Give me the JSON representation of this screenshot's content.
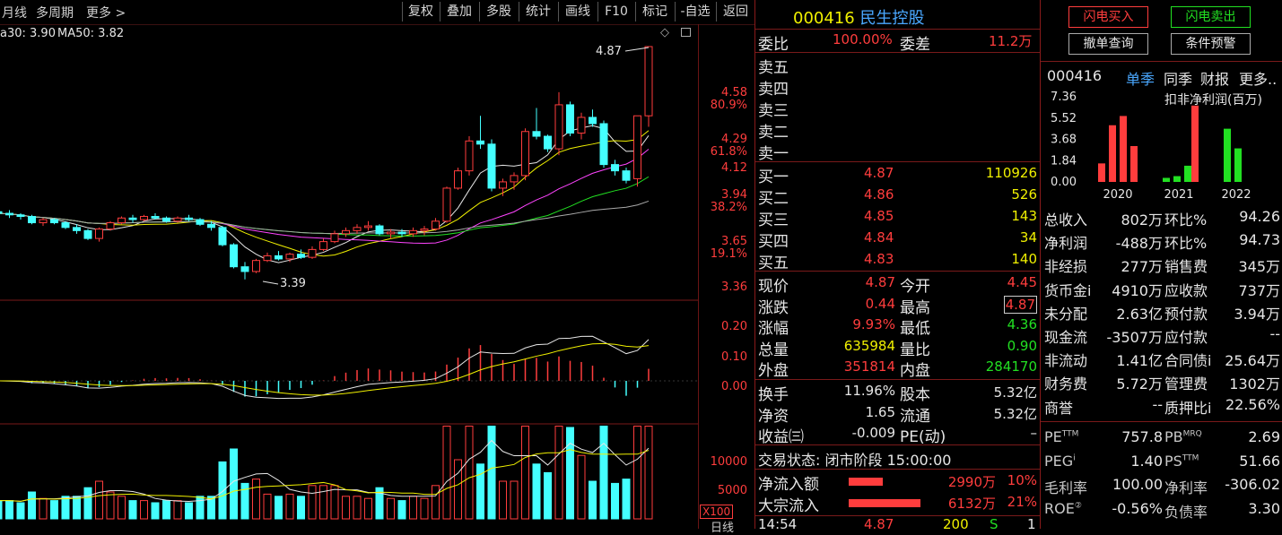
{
  "toolbar": {
    "tabs": [
      "月线",
      "多周期",
      "更多 >"
    ],
    "buttons": [
      "复权",
      "叠加",
      "多股",
      "统计",
      "画线",
      "F10",
      "标记",
      "-自选",
      "返回"
    ]
  },
  "ma_legend": {
    "ma30": "a30: 3.90",
    "ma50": "MA50: 3.82"
  },
  "price_axis": [
    {
      "label": "4.58",
      "color": "#ff3d3d"
    },
    {
      "label": "80.9%",
      "color": "#ff3d3d"
    },
    {
      "label": "4.29",
      "color": "#ff3d3d"
    },
    {
      "label": "61.8%",
      "color": "#ff3d3d"
    },
    {
      "label": "4.12",
      "color": "#ff3d3d"
    },
    {
      "label": "3.94",
      "color": "#ff3d3d"
    },
    {
      "label": "38.2%",
      "color": "#ff3d3d"
    },
    {
      "label": "3.65",
      "color": "#ff3d3d"
    },
    {
      "label": "19.1%",
      "color": "#ff3d3d"
    },
    {
      "label": "3.36",
      "color": "#ff3d3d"
    }
  ],
  "price_marks": {
    "high": "4.87",
    "low": "3.39"
  },
  "macd_axis": [
    "0.20",
    "0.10",
    "0.00"
  ],
  "vol_axis": [
    "10000",
    "5000"
  ],
  "vol_unit": "X100",
  "bottom_right": "日线",
  "chart_data": {
    "type": "candlestick",
    "candles": [
      [
        3.82,
        3.84,
        3.79,
        3.81
      ],
      [
        3.81,
        3.83,
        3.78,
        3.8
      ],
      [
        3.8,
        3.81,
        3.77,
        3.79
      ],
      [
        3.79,
        3.8,
        3.74,
        3.75
      ],
      [
        3.75,
        3.78,
        3.73,
        3.77
      ],
      [
        3.77,
        3.78,
        3.74,
        3.75
      ],
      [
        3.75,
        3.76,
        3.71,
        3.72
      ],
      [
        3.72,
        3.74,
        3.68,
        3.7
      ],
      [
        3.7,
        3.71,
        3.64,
        3.65
      ],
      [
        3.65,
        3.72,
        3.63,
        3.71
      ],
      [
        3.71,
        3.76,
        3.7,
        3.75
      ],
      [
        3.75,
        3.79,
        3.74,
        3.78
      ],
      [
        3.78,
        3.8,
        3.75,
        3.77
      ],
      [
        3.77,
        3.8,
        3.76,
        3.79
      ],
      [
        3.79,
        3.81,
        3.77,
        3.78
      ],
      [
        3.78,
        3.79,
        3.75,
        3.76
      ],
      [
        3.76,
        3.79,
        3.75,
        3.78
      ],
      [
        3.78,
        3.8,
        3.76,
        3.77
      ],
      [
        3.77,
        3.78,
        3.73,
        3.74
      ],
      [
        3.74,
        3.76,
        3.7,
        3.72
      ],
      [
        3.72,
        3.73,
        3.6,
        3.61
      ],
      [
        3.61,
        3.62,
        3.46,
        3.47
      ],
      [
        3.47,
        3.5,
        3.39,
        3.44
      ],
      [
        3.44,
        3.52,
        3.43,
        3.51
      ],
      [
        3.51,
        3.56,
        3.5,
        3.54
      ],
      [
        3.54,
        3.57,
        3.51,
        3.52
      ],
      [
        3.52,
        3.56,
        3.5,
        3.55
      ],
      [
        3.55,
        3.58,
        3.52,
        3.53
      ],
      [
        3.53,
        3.6,
        3.52,
        3.58
      ],
      [
        3.58,
        3.65,
        3.57,
        3.63
      ],
      [
        3.63,
        3.7,
        3.62,
        3.68
      ],
      [
        3.68,
        3.72,
        3.66,
        3.7
      ],
      [
        3.7,
        3.74,
        3.68,
        3.72
      ],
      [
        3.72,
        3.76,
        3.7,
        3.73
      ],
      [
        3.73,
        3.74,
        3.67,
        3.68
      ],
      [
        3.68,
        3.71,
        3.65,
        3.69
      ],
      [
        3.69,
        3.71,
        3.66,
        3.68
      ],
      [
        3.68,
        3.72,
        3.66,
        3.7
      ],
      [
        3.7,
        3.73,
        3.67,
        3.71
      ],
      [
        3.71,
        3.78,
        3.7,
        3.76
      ],
      [
        3.76,
        3.98,
        3.75,
        3.97
      ],
      [
        3.97,
        4.1,
        3.96,
        4.08
      ],
      [
        4.08,
        4.3,
        4.05,
        4.27
      ],
      [
        4.27,
        4.43,
        4.22,
        4.25
      ],
      [
        4.25,
        4.28,
        3.95,
        3.97
      ],
      [
        3.97,
        4.03,
        3.92,
        4.01
      ],
      [
        4.01,
        4.07,
        3.96,
        4.05
      ],
      [
        4.05,
        4.35,
        4.02,
        4.33
      ],
      [
        4.33,
        4.48,
        4.28,
        4.3
      ],
      [
        4.3,
        4.31,
        4.2,
        4.22
      ],
      [
        4.22,
        4.58,
        4.18,
        4.5
      ],
      [
        4.5,
        4.52,
        4.3,
        4.32
      ],
      [
        4.32,
        4.45,
        4.28,
        4.42
      ],
      [
        4.42,
        4.47,
        4.36,
        4.38
      ],
      [
        4.38,
        4.4,
        4.1,
        4.12
      ],
      [
        4.12,
        4.15,
        4.05,
        4.08
      ],
      [
        4.08,
        4.1,
        4.0,
        4.02
      ],
      [
        4.03,
        4.42,
        3.98,
        4.43
      ],
      [
        4.43,
        4.87,
        4.36,
        4.87
      ]
    ],
    "vol_ylim": [
      0,
      15000
    ],
    "macd_ylim": [
      -0.06,
      0.24
    ]
  },
  "quote": {
    "code": "000416",
    "name": "民生控股",
    "weibi_label": "委比",
    "weibi_val": "100.00%",
    "weicha_label": "委差",
    "weicha_val": "11.2万",
    "sell": [
      {
        "label": "卖五"
      },
      {
        "label": "卖四"
      },
      {
        "label": "卖三"
      },
      {
        "label": "卖二"
      },
      {
        "label": "卖一"
      }
    ],
    "buy": [
      {
        "label": "买一",
        "price": "4.87",
        "vol": "110926"
      },
      {
        "label": "买二",
        "price": "4.86",
        "vol": "526"
      },
      {
        "label": "买三",
        "price": "4.85",
        "vol": "143"
      },
      {
        "label": "买四",
        "price": "4.84",
        "vol": "34"
      },
      {
        "label": "买五",
        "price": "4.83",
        "vol": "140"
      }
    ],
    "stats": [
      {
        "l1": "现价",
        "v1": "4.87",
        "c1": "#ff3d3d",
        "l2": "今开",
        "v2": "4.45",
        "c2": "#ff3d3d"
      },
      {
        "l1": "涨跌",
        "v1": "0.44",
        "c1": "#ff3d3d",
        "l2": "最高",
        "v2": "4.87",
        "c2": "#ff3d3d"
      },
      {
        "l1": "涨幅",
        "v1": "9.93%",
        "c1": "#ff3d3d",
        "l2": "最低",
        "v2": "4.36",
        "c2": "#22e022"
      },
      {
        "l1": "总量",
        "v1": "635984",
        "c1": "#f0f000",
        "l2": "量比",
        "v2": "0.90",
        "c2": "#22e022"
      },
      {
        "l1": "外盘",
        "v1": "351814",
        "c1": "#ff3d3d",
        "l2": "内盘",
        "v2": "284170",
        "c2": "#22e022"
      }
    ],
    "stats2": [
      {
        "l1": "换手",
        "v1": "11.96%",
        "l2": "股本",
        "v2": "5.32亿"
      },
      {
        "l1": "净资",
        "v1": "1.65",
        "l2": "流通",
        "v2": "5.32亿"
      },
      {
        "l1": "收益㈢",
        "v1": "-0.009",
        "l2": "PE(动)",
        "v2": "–"
      }
    ],
    "status": "交易状态: 闭市阶段 15:00:00",
    "flows": [
      {
        "label": "净流入额",
        "val": "2990万",
        "pct": "10%",
        "ratio": 0.1
      },
      {
        "label": "大宗流入",
        "val": "6132万",
        "pct": "21%",
        "ratio": 0.21
      }
    ],
    "tick": {
      "time": "14:54",
      "price": "4.87",
      "vol": "200",
      "side": "S",
      "n": "1"
    }
  },
  "right": {
    "buttons": [
      {
        "label": "闪电买入",
        "color": "#ff3d3d"
      },
      {
        "label": "闪电卖出",
        "color": "#22e022"
      },
      {
        "label": "撤单查询",
        "color": "#e6e6e6"
      },
      {
        "label": "条件预警",
        "color": "#e6e6e6"
      }
    ],
    "tabs": {
      "code": "000416",
      "t1": "单季",
      "t2": "同季",
      "t3": "财报",
      "t4": "更多.."
    },
    "profit_title": "扣非净利润(百万)",
    "profit_axis": [
      "7.36",
      "5.52",
      "3.68",
      "1.84",
      "0.00"
    ],
    "profit_years": [
      "2020",
      "2021",
      "2022"
    ],
    "profit_bars": [
      {
        "v": 1.6,
        "c": "#ff3d3d"
      },
      {
        "v": 4.9,
        "c": "#ff3d3d"
      },
      {
        "v": 5.7,
        "c": "#ff3d3d"
      },
      {
        "v": 3.1,
        "c": "#ff3d3d"
      },
      {
        "v": 0.35,
        "c": "#22e022"
      },
      {
        "v": 0.5,
        "c": "#22e022"
      },
      {
        "v": 1.4,
        "c": "#22e022"
      },
      {
        "v": 6.6,
        "c": "#ff3d3d"
      },
      {
        "v": 4.6,
        "c": "#22e022"
      },
      {
        "v": 2.9,
        "c": "#22e022"
      }
    ],
    "fin": [
      {
        "l1": "总收入",
        "v1": "802万",
        "l2": "环比%",
        "v2": "94.26"
      },
      {
        "l1": "净利润",
        "v1": "-488万",
        "l2": "环比%",
        "v2": "94.73"
      },
      {
        "l1": "非经损",
        "v1": "277万",
        "l2": "销售费",
        "v2": "345万"
      },
      {
        "l1": "货币金i",
        "v1": "4910万",
        "l2": "应收款",
        "v2": "737万"
      },
      {
        "l1": "未分配",
        "v1": "2.63亿",
        "l2": "预付款",
        "v2": "3.94万"
      },
      {
        "l1": "现金流",
        "v1": "-3507万",
        "l2": "应付款",
        "v2": "--"
      },
      {
        "l1": "非流动",
        "v1": "1.41亿",
        "l2": "合同债i",
        "v2": "25.64万"
      },
      {
        "l1": "财务费",
        "v1": "5.72万",
        "l2": "管理费",
        "v2": "1302万"
      },
      {
        "l1": "商誉",
        "v1": "--",
        "l2": "质押比i",
        "v2": "22.56%"
      }
    ],
    "val": [
      {
        "l1": "PE",
        "s1": "TTM",
        "v1": "757.8",
        "l2": "PB",
        "s2": "MRQ",
        "v2": "2.69"
      },
      {
        "l1": "PEG",
        "s1": "i",
        "v1": "1.40",
        "l2": "PS",
        "s2": "TTM",
        "v2": "51.66"
      },
      {
        "l1": "毛利率",
        "s1": "",
        "v1": "100.00",
        "l2": "净利率",
        "s2": "",
        "v2": "-306.02"
      },
      {
        "l1": "ROE",
        "s1": "②",
        "v1": "-0.56%",
        "l2": "负债率",
        "s2": "",
        "v2": "3.30"
      }
    ]
  }
}
